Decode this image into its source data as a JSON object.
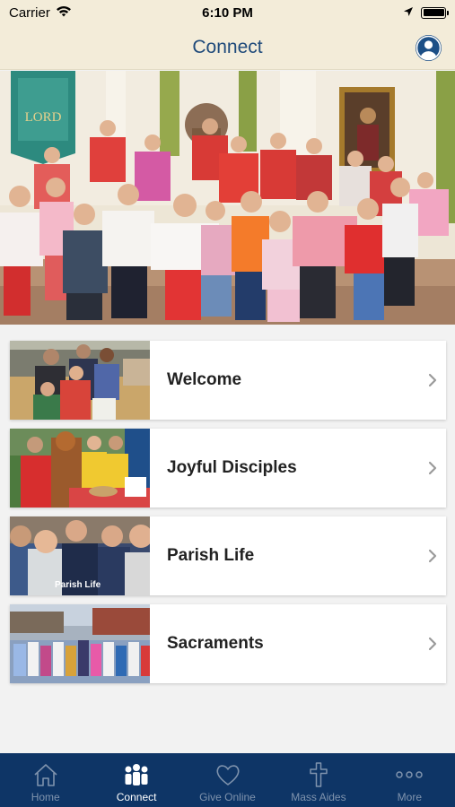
{
  "status_bar": {
    "carrier": "Carrier",
    "time": "6:10 PM"
  },
  "nav": {
    "title": "Connect",
    "profile_icon": "person-icon"
  },
  "hero": {
    "banner_top": "LORD",
    "banner_word": "LORD"
  },
  "cards": [
    {
      "label": "Welcome",
      "thumb_caption": ""
    },
    {
      "label": "Joyful Disciples",
      "thumb_caption": ""
    },
    {
      "label": "Parish Life",
      "thumb_caption": "Parish Life"
    },
    {
      "label": "Sacraments",
      "thumb_caption": ""
    }
  ],
  "tabs": [
    {
      "label": "Home",
      "icon": "home-icon",
      "active": false
    },
    {
      "label": "Connect",
      "icon": "people-icon",
      "active": true
    },
    {
      "label": "Give Online",
      "icon": "heart-icon",
      "active": false
    },
    {
      "label": "Mass Aides",
      "icon": "cross-icon",
      "active": false
    },
    {
      "label": "More",
      "icon": "more-icon",
      "active": false
    }
  ],
  "colors": {
    "header_bg": "#f3ecd9",
    "title": "#1f4a7a",
    "tab_bar": "#0e3566",
    "tab_inactive": "#7f93ad"
  }
}
